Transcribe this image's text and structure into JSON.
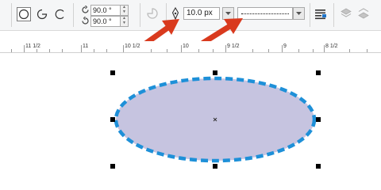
{
  "toolbar": {
    "shapes": {
      "full_ellipse": "full-ellipse-icon",
      "pie": "pie-icon",
      "arc": "arc-icon"
    },
    "start_angle": {
      "icon": "start-angle-icon",
      "value": "90.0 °"
    },
    "end_angle": {
      "icon": "end-angle-icon",
      "value": "90.0 °"
    },
    "direction_icon": "change-direction-icon",
    "outline_width": {
      "icon": "pen-nib-icon",
      "value": "10.0 px"
    },
    "line_style": {
      "name": "dotted-line"
    },
    "wrap_icon": "text-wrap-icon",
    "to_front_icon": "to-front-icon",
    "to_back_icon": "to-back-icon"
  },
  "ruler": {
    "labels": [
      "11 1/2",
      "11",
      "10 1/2",
      "10",
      "9 1/2",
      "9",
      "8 1/2"
    ]
  },
  "canvas": {
    "shape": "ellipse",
    "fill_color": "#c6c4e0",
    "outline_color": "#1e90d8"
  },
  "annotations": {
    "color": "#d93a1e",
    "arrows": [
      "arrow-to-outline-width",
      "arrow-to-line-style"
    ]
  }
}
